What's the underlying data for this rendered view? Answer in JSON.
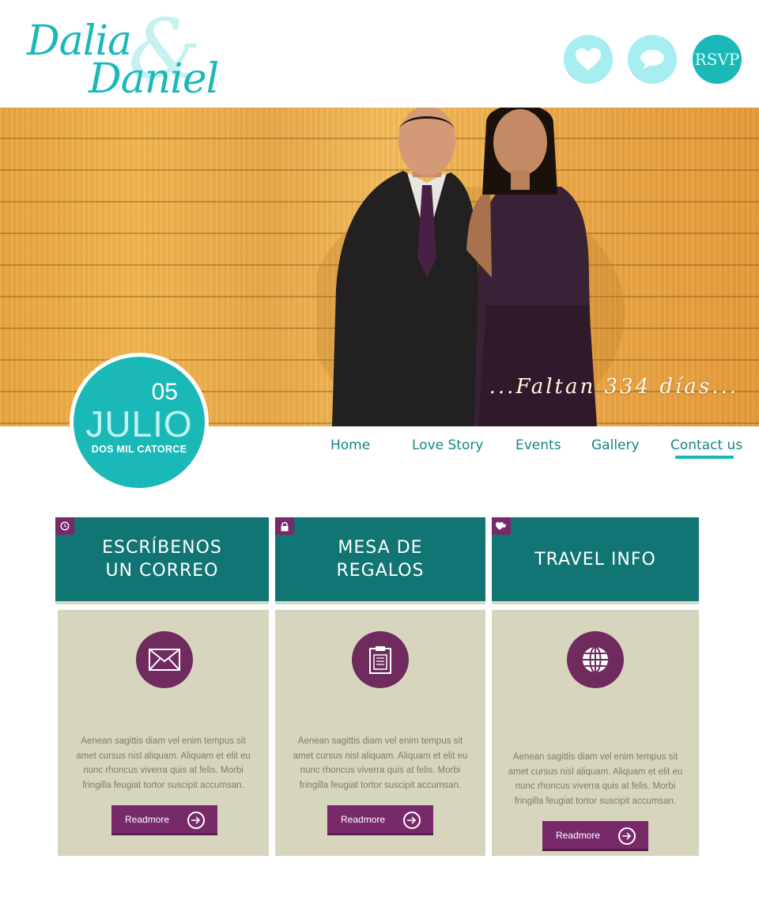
{
  "brand": {
    "name_first": "Dalia",
    "ampersand": "&",
    "name_second": "Daniel",
    "accent": "#1ab9b7",
    "accent_light": "#a6eeef"
  },
  "header_actions": [
    {
      "name": "heart",
      "icon": "heart-icon"
    },
    {
      "name": "chat",
      "icon": "speech-bubble-icon"
    },
    {
      "name": "rsvp",
      "label": "RSVP"
    }
  ],
  "hero": {
    "countdown": "...Faltan 334 días..."
  },
  "date_badge": {
    "day": "05",
    "month": "JULIO",
    "year_text": "DOS MIL CATORCE"
  },
  "nav": {
    "items": [
      "Home",
      "Love Story",
      "Events",
      "Gallery",
      "Contact us"
    ],
    "active": "Contact us"
  },
  "cards": [
    {
      "title_line1": "ESCRÍBENOS",
      "title_line2": "UN CORREO",
      "corner_icon": "clock-icon",
      "icon": "envelope-icon",
      "text": "Aenean sagittis diam vel enim tempus sit amet cursus nisl aliquam. Aliquam et elit eu nunc rhoncus viverra quis at felis. Morbi fringilla feugiat tortor suscipit accumsan.",
      "button": "Readmore"
    },
    {
      "title_line1": "MESA DE",
      "title_line2": "REGALOS",
      "corner_icon": "lock-icon",
      "icon": "clipboard-icon",
      "text": "Aenean sagittis diam vel enim tempus sit amet cursus nisl aliquam. Aliquam et elit eu nunc rhoncus viverra quis at felis. Morbi fringilla feugiat tortor suscipit accumsan.",
      "button": "Readmore"
    },
    {
      "title_line1": "TRAVEL INFO",
      "title_line2": "",
      "corner_icon": "hearts-icon",
      "icon": "globe-icon",
      "text": "Aenean sagittis diam vel enim tempus sit amet cursus nisl aliquam. Aliquam et elit eu nunc rhoncus viverra quis at felis. Morbi fringilla feugiat tortor suscipit accumsan.",
      "button": "Readmore"
    }
  ],
  "colors": {
    "card_head": "#117574",
    "card_body": "#d8d5be",
    "plum": "#77296a"
  }
}
